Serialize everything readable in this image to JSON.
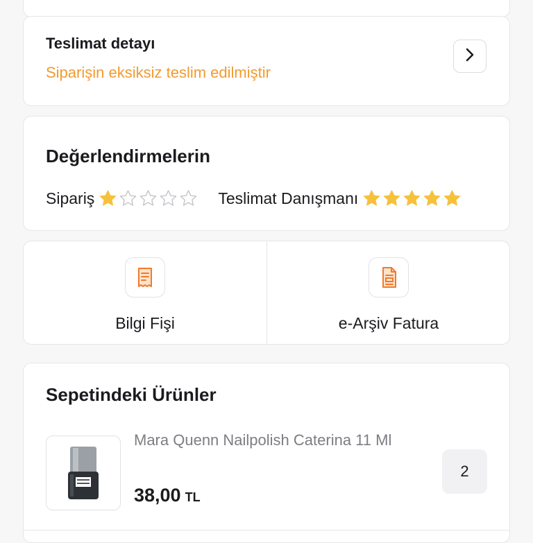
{
  "delivery": {
    "title": "Teslimat detayı",
    "status": "Siparişin eksiksiz teslim edilmiştir",
    "status_color": "#f29a2e"
  },
  "ratings": {
    "title": "Değerlendirmelerin",
    "order_label": "Sipariş",
    "order_stars": 1,
    "courier_label": "Teslimat Danışmanı",
    "courier_stars": 5,
    "max_stars": 5,
    "star_color": "#f6c13b"
  },
  "documents": [
    {
      "label": "Bilgi Fişi",
      "icon": "receipt-icon"
    },
    {
      "label": "e-Arşiv Fatura",
      "icon": "invoice-document-icon"
    }
  ],
  "basket": {
    "title": "Sepetindeki Ürünler",
    "items": [
      {
        "name": "Mara Quenn Nailpolish Caterina 11 Ml",
        "price": "38,00",
        "currency": "TL",
        "quantity": "2",
        "image": "nail-polish-bottle"
      }
    ]
  },
  "colors": {
    "accent": "#f29a2e",
    "background": "#f7f7f8",
    "card": "#ffffff"
  }
}
